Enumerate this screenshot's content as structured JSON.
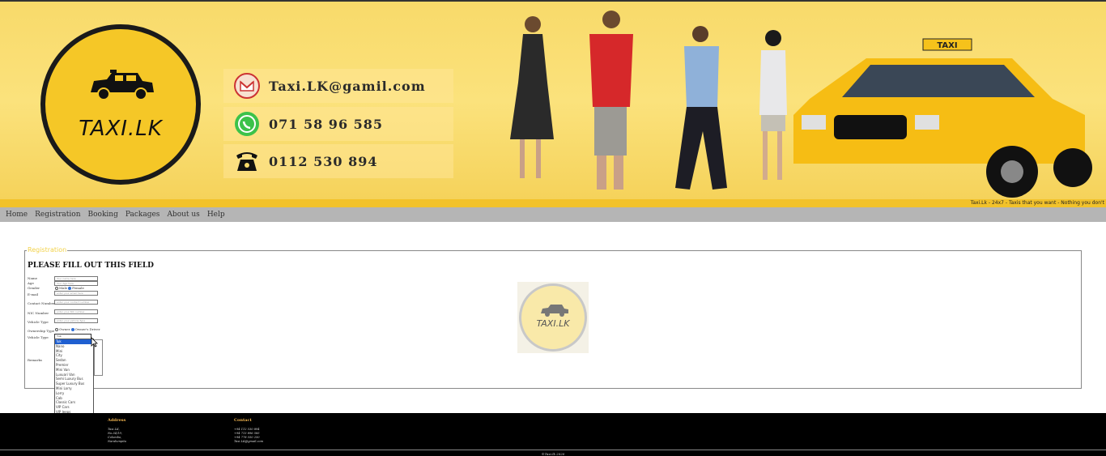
{
  "banner": {
    "logo_text": "TAXI.LK",
    "email": "Taxi.LK@gamil.com",
    "whatsapp": "071 58 96 585",
    "phone": "0112 530 894",
    "tagline": "Taxi.Lk - 24x7 - Taxis that you want - Nothing you don't",
    "taxi_sign": "TAXI"
  },
  "nav": [
    "Home",
    "Registration",
    "Booking",
    "Packages",
    "About us",
    "Help"
  ],
  "form": {
    "legend": "Registration",
    "title": "PLEASE FILL OUT THIS FIELD",
    "labels": {
      "name": "Name",
      "age": "Age",
      "gender": "Gender",
      "email": "E-mail",
      "contact": "Contact Number",
      "nic": "NIC Number",
      "vehicle_type_1": "Vehicle Type",
      "ownership": "Ownership Type",
      "vehicle_type_2": "Vehicle Type",
      "remarks": "Remarks"
    },
    "placeholders": {
      "name": "Your name here",
      "age": "Your Age here",
      "email": "enter your email here",
      "contact": "enter your contact number",
      "nic": "enter your NIC number",
      "vehicle_type": "enter your vehicle Type"
    },
    "gender_options": [
      "Male",
      "Female"
    ],
    "ownership_options": [
      "Owner",
      "Owner's Driver"
    ],
    "select_value": "Tuk",
    "vehicle_options": [
      "Tuk",
      "Nano",
      "Mini",
      "City",
      "Sedan",
      "Premier",
      "Mini Van",
      "Luxuari Van",
      "Semi Luxury Bus",
      "Super Luxury Bus",
      "Mini Lorry",
      "Lorry",
      "Cab",
      "Classic Cars",
      "VIP Cars",
      "VIP Jeeps"
    ]
  },
  "center_logo_text": "TAXI.LK",
  "footer": {
    "address_head": "Address",
    "address_lines": [
      "Taxi.LK,",
      "No.34/19,",
      "Colombo,",
      "Narahenpita"
    ],
    "contact_head": "Contact",
    "contact_lines": [
      "+94 112 530 894",
      "+94 713 896 585",
      "+94 778 550 250",
      "Taxi.LK@gmail.com"
    ],
    "copyright": "©Taxi.lk 2020"
  },
  "colors": {
    "banner": "#f8da6a",
    "nav": "#b5b5b5",
    "footer": "#000000",
    "footer_head": "#f1b44f",
    "legend": "#f2d24a"
  }
}
